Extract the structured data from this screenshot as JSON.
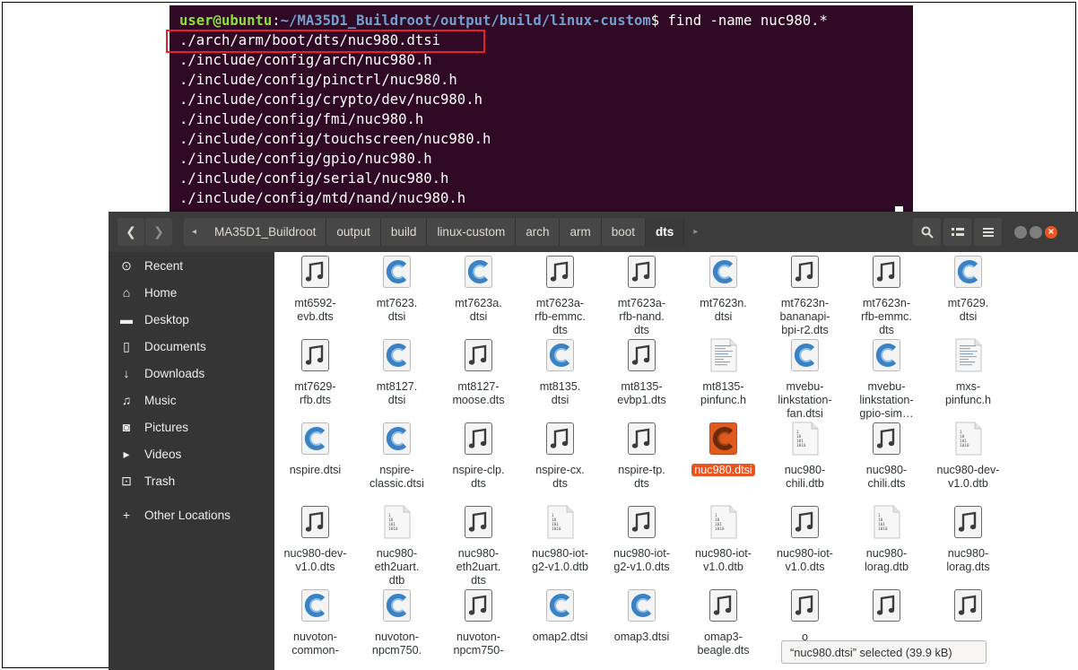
{
  "terminal": {
    "prompt_user": "user@ubuntu",
    "prompt_sep": ":",
    "prompt_path": "~/MA35D1_Buildroot/output/build/linux-custom",
    "prompt_symbol": "$ ",
    "command": "find -name nuc980.*",
    "output": [
      "./arch/arm/boot/dts/nuc980.dtsi",
      "./include/config/arch/nuc980.h",
      "./include/config/pinctrl/nuc980.h",
      "./include/config/crypto/dev/nuc980.h",
      "./include/config/fmi/nuc980.h",
      "./include/config/touchscreen/nuc980.h",
      "./include/config/gpio/nuc980.h",
      "./include/config/serial/nuc980.h",
      "./include/config/mtd/nand/nuc980.h"
    ]
  },
  "file_manager": {
    "back_icon": "chevron-left-icon",
    "forward_icon": "chevron-right-icon",
    "breadcrumbs": [
      "MA35D1_Buildroot",
      "output",
      "build",
      "linux-custom",
      "arch",
      "arm",
      "boot",
      "dts"
    ],
    "breadcrumb_left_arrow": "◂",
    "breadcrumb_right_arrow": "▸",
    "active_crumb": "dts",
    "tools": [
      {
        "icon": "search-icon",
        "glyph": "⌕"
      },
      {
        "icon": "view-toggle-icon",
        "glyph": "☷"
      },
      {
        "icon": "menu-icon",
        "glyph": "≡"
      }
    ],
    "window_controls": {
      "minimize_color": "#7d7d7d",
      "maximize_color": "#7d7d7d",
      "close_color": "#e95420"
    },
    "sidebar": [
      {
        "label": "Recent",
        "icon": "clock-icon",
        "glyph": "⊙"
      },
      {
        "label": "Home",
        "icon": "home-icon",
        "glyph": "⌂"
      },
      {
        "label": "Desktop",
        "icon": "folder-icon",
        "glyph": "▬"
      },
      {
        "label": "Documents",
        "icon": "document-icon",
        "glyph": "▯"
      },
      {
        "label": "Downloads",
        "icon": "download-icon",
        "glyph": "↓"
      },
      {
        "label": "Music",
        "icon": "music-icon",
        "glyph": "♫"
      },
      {
        "label": "Pictures",
        "icon": "camera-icon",
        "glyph": "◙"
      },
      {
        "label": "Videos",
        "icon": "video-icon",
        "glyph": "▸"
      },
      {
        "label": "Trash",
        "icon": "trash-icon",
        "glyph": "⊡"
      },
      {
        "label": "Other Locations",
        "icon": "plus-icon",
        "glyph": "+"
      }
    ],
    "files": [
      {
        "name": "mt6592-\nevb.dts",
        "type": "music"
      },
      {
        "name": "mt7623.\ndtsi",
        "type": "c"
      },
      {
        "name": "mt7623a.\ndtsi",
        "type": "c"
      },
      {
        "name": "mt7623a-\nrfb-emmc.\ndts",
        "type": "music"
      },
      {
        "name": "mt7623a-\nrfb-nand.\ndts",
        "type": "music"
      },
      {
        "name": "mt7623n.\ndtsi",
        "type": "c"
      },
      {
        "name": "mt7623n-\nbananapi-\nbpi-r2.dts",
        "type": "music"
      },
      {
        "name": "mt7623n-\nrfb-emmc.\ndts",
        "type": "music"
      },
      {
        "name": "mt7629.\ndtsi",
        "type": "c"
      },
      {
        "name": "mt7629-\nrfb.dts",
        "type": "music"
      },
      {
        "name": "mt8127.\ndtsi",
        "type": "c"
      },
      {
        "name": "mt8127-\nmoose.dts",
        "type": "music"
      },
      {
        "name": "mt8135.\ndtsi",
        "type": "c"
      },
      {
        "name": "mt8135-\nevbp1.dts",
        "type": "music"
      },
      {
        "name": "mt8135-\npinfunc.h",
        "type": "text"
      },
      {
        "name": "mvebu-\nlinkstation-\nfan.dtsi",
        "type": "c"
      },
      {
        "name": "mvebu-\nlinkstation-\ngpio-sim…",
        "type": "c"
      },
      {
        "name": "mxs-\npinfunc.h",
        "type": "text"
      },
      {
        "name": "nspire.dtsi",
        "type": "c"
      },
      {
        "name": "nspire-\nclassic.dtsi",
        "type": "c"
      },
      {
        "name": "nspire-clp.\ndts",
        "type": "music"
      },
      {
        "name": "nspire-cx.\ndts",
        "type": "music"
      },
      {
        "name": "nspire-tp.\ndts",
        "type": "music"
      },
      {
        "name": "nuc980.dtsi",
        "type": "c-selected",
        "selected": true
      },
      {
        "name": "nuc980-\nchili.dtb",
        "type": "binary"
      },
      {
        "name": "nuc980-\nchili.dts",
        "type": "music"
      },
      {
        "name": "nuc980-dev-\nv1.0.dtb",
        "type": "binary"
      },
      {
        "name": "nuc980-dev-\nv1.0.dts",
        "type": "music"
      },
      {
        "name": "nuc980-\neth2uart.\ndtb",
        "type": "binary"
      },
      {
        "name": "nuc980-\neth2uart.\ndts",
        "type": "music"
      },
      {
        "name": "nuc980-iot-\ng2-v1.0.dtb",
        "type": "binary"
      },
      {
        "name": "nuc980-iot-\ng2-v1.0.dts",
        "type": "music"
      },
      {
        "name": "nuc980-iot-\nv1.0.dtb",
        "type": "binary"
      },
      {
        "name": "nuc980-iot-\nv1.0.dts",
        "type": "music"
      },
      {
        "name": "nuc980-\nlorag.dtb",
        "type": "binary"
      },
      {
        "name": "nuc980-\nlorag.dts",
        "type": "music"
      },
      {
        "name": "nuvoton-\ncommon-",
        "type": "c"
      },
      {
        "name": "nuvoton-\nnpcm750.",
        "type": "c"
      },
      {
        "name": "nuvoton-\nnpcm750-",
        "type": "music"
      },
      {
        "name": "omap2.dtsi",
        "type": "c"
      },
      {
        "name": "omap3.dtsi",
        "type": "c"
      },
      {
        "name": "omap3-\nbeagle.dts",
        "type": "music"
      },
      {
        "name": "o\nbea",
        "type": "music"
      },
      {
        "name": "",
        "type": "music"
      },
      {
        "name": "",
        "type": "music"
      }
    ],
    "binary_text": [
      "1",
      "10",
      "101",
      "1010"
    ],
    "status_text": "“nuc980.dtsi” selected  (39.9 kB)"
  }
}
